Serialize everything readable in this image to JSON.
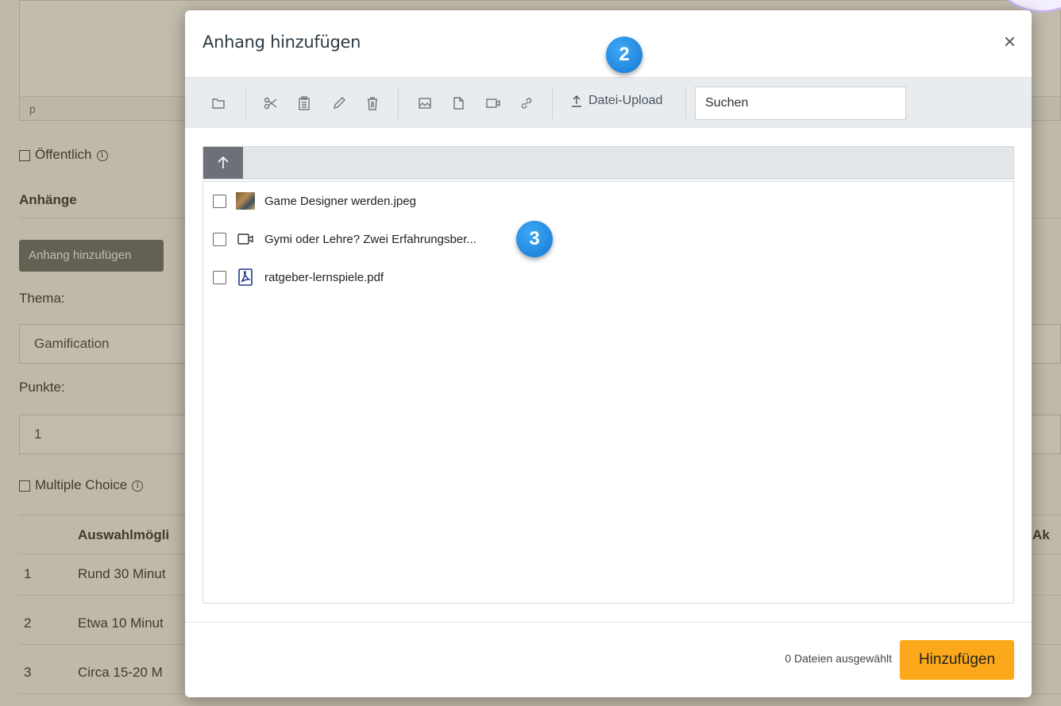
{
  "background": {
    "editor_status": "p",
    "public_label": "Öffentlich",
    "attachments_heading": "Anhänge",
    "add_attachment_button": "Anhang hinzufügen",
    "topic_label": "Thema:",
    "topic_value": "Gamification",
    "points_label": "Punkte:",
    "points_value": "1",
    "multiple_choice_label": "Multiple Choice",
    "table_headers": [
      "Auswahlmögli",
      "Ak"
    ],
    "table_rows": [
      {
        "num": "1",
        "text": "Rund 30 Minut"
      },
      {
        "num": "2",
        "text": "Etwa 10 Minut"
      },
      {
        "num": "3",
        "text": "Circa 15-20 M"
      }
    ]
  },
  "modal": {
    "title": "Anhang hinzufügen",
    "close_label": "×",
    "toolbar": {
      "upload_label": "Datei-Upload",
      "search_placeholder": "Suchen"
    },
    "files": [
      {
        "name": "Game Designer werden.jpeg",
        "icon": "image-thumbnail"
      },
      {
        "name": "Gymi oder Lehre? Zwei Erfahrungsber...",
        "icon": "video-icon"
      },
      {
        "name": "ratgeber-lernspiele.pdf",
        "icon": "pdf-icon"
      }
    ],
    "footer": {
      "selected_count": "0 Dateien ausgewählt",
      "add_button": "Hinzufügen"
    }
  },
  "badges": [
    "2",
    "3"
  ],
  "colors": {
    "accent_button": "#fba91a",
    "badge_blue": "#1478d4",
    "toolbar_bg": "#e8ecef"
  }
}
